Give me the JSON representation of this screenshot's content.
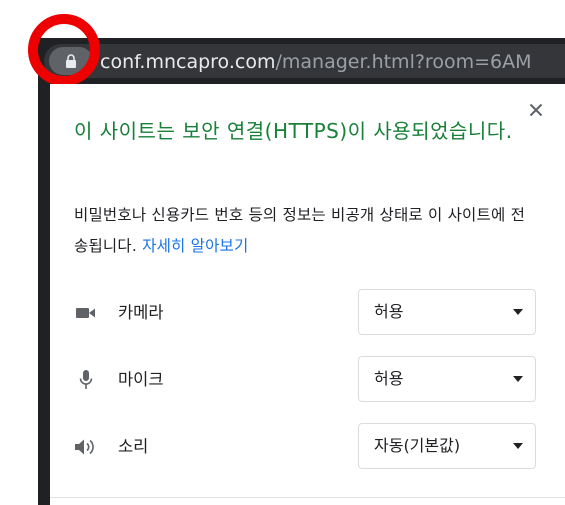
{
  "address_bar": {
    "url_host": "conf.mncapro.com",
    "url_path": "/manager.html?room=6AM"
  },
  "site_info_popup": {
    "title": "이 사이트는 보안 연결(HTTPS)이 사용되었습니다.",
    "description": "비밀번호나 신용카드 번호 등의 정보는 비공개 상태로 이 사이트에 전송됩니다. ",
    "learn_more_link": "자세히 알아보기",
    "permissions": [
      {
        "icon": "camera-icon",
        "label": "카메라",
        "value": "허용"
      },
      {
        "icon": "microphone-icon",
        "label": "마이크",
        "value": "허용"
      },
      {
        "icon": "speaker-icon",
        "label": "소리",
        "value": "자동(기본값)"
      }
    ]
  },
  "colors": {
    "secure_title": "#188038",
    "link": "#1a73e8",
    "annotation_ring": "#ee0000"
  }
}
